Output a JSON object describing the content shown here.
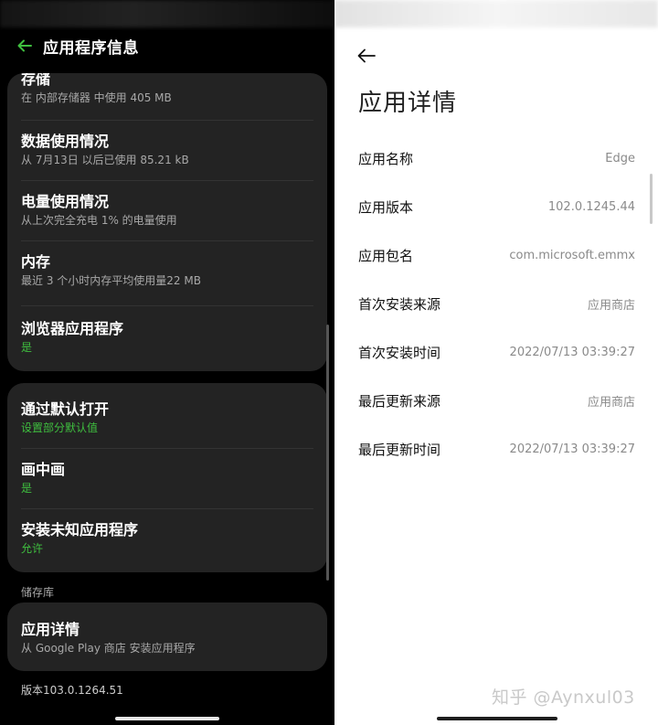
{
  "left": {
    "title": "应用程序信息",
    "card1": [
      {
        "title": "存储",
        "subtitle": "在 内部存储器 中使用 405 MB"
      },
      {
        "title": "数据使用情况",
        "subtitle": "从 7月13日 以后已使用 85.21 kB"
      },
      {
        "title": "电量使用情况",
        "subtitle": "从上次完全充电 1% 的电量使用"
      },
      {
        "title": "内存",
        "subtitle": "最近 3 个小时内存平均使用量22 MB"
      },
      {
        "title": "浏览器应用程序",
        "subtitle": "是"
      }
    ],
    "card2": [
      {
        "title": "通过默认打开",
        "subtitle": "设置部分默认值"
      },
      {
        "title": "画中画",
        "subtitle": "是"
      },
      {
        "title": "安装未知应用程序",
        "subtitle": "允许"
      }
    ],
    "section_label": "储存库",
    "card3": {
      "title": "应用详情",
      "subtitle": "从 Google Play 商店 安装应用程序"
    },
    "version": "版本103.0.1264.51",
    "accent_color": "#3fbf3f"
  },
  "right": {
    "title": "应用详情",
    "rows": [
      {
        "key": "应用名称",
        "value": "Edge"
      },
      {
        "key": "应用版本",
        "value": "102.0.1245.44"
      },
      {
        "key": "应用包名",
        "value": "com.microsoft.emmx"
      },
      {
        "key": "首次安装来源",
        "value": "应用商店"
      },
      {
        "key": "首次安装时间",
        "value": "2022/07/13 03:39:27"
      },
      {
        "key": "最后更新来源",
        "value": "应用商店"
      },
      {
        "key": "最后更新时间",
        "value": "2022/07/13 03:39:27"
      }
    ],
    "watermark": "知乎 @Aynxul03"
  }
}
